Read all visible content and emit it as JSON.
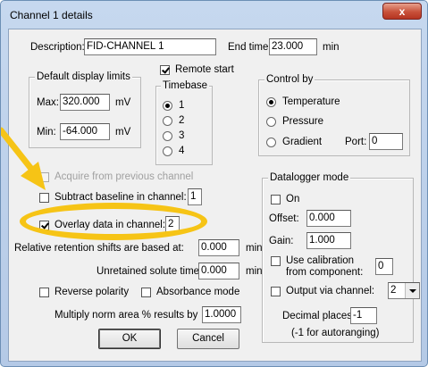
{
  "window": {
    "title": "Channel 1 details",
    "close_label": "x"
  },
  "description": {
    "label": "Description:",
    "value": "FID-CHANNEL 1"
  },
  "end_time": {
    "label": "End time:",
    "value": "23.000",
    "unit": "min"
  },
  "display_limits": {
    "title": "Default display limits",
    "max_label": "Max:",
    "max_value": "320.000",
    "max_unit": "mV",
    "min_label": "Min:",
    "min_value": "-64.000",
    "min_unit": "mV"
  },
  "remote_start": {
    "label": "Remote start",
    "checked": true
  },
  "timebase": {
    "title": "Timebase",
    "options": [
      "1",
      "2",
      "3",
      "4"
    ],
    "selected": "1"
  },
  "control_by": {
    "title": "Control by",
    "options": [
      "Temperature",
      "Pressure",
      "Gradient"
    ],
    "selected": "Temperature",
    "port_label": "Port:",
    "port_value": "0"
  },
  "acquire_previous": {
    "label": "Acquire from previous channel",
    "checked": false,
    "enabled": false
  },
  "subtract_baseline": {
    "label": "Subtract baseline in channel:",
    "value": "1",
    "checked": false
  },
  "overlay": {
    "label": "Overlay data in channel:",
    "value": "2",
    "checked": true
  },
  "relative_retention": {
    "label": "Relative retention shifts are based at:",
    "value": "0.000",
    "unit": "min"
  },
  "unretained": {
    "label": "Unretained solute time:",
    "value": "0.000",
    "unit": "min"
  },
  "reverse_polarity": {
    "label": "Reverse polarity",
    "checked": false
  },
  "absorbance_mode": {
    "label": "Absorbance mode",
    "checked": false
  },
  "multiply_norm": {
    "label": "Multiply norm area % results by",
    "value": "1.0000"
  },
  "datalogger": {
    "title": "Datalogger mode",
    "on_label": "On",
    "offset_label": "Offset:",
    "offset_value": "0.000",
    "gain_label": "Gain:",
    "gain_value": "1.000",
    "calibration_label_1": "Use calibration",
    "calibration_label_2": "from component:",
    "calibration_value": "0",
    "output_label": "Output via channel:",
    "output_value": "2",
    "decimal_label": "Decimal places:",
    "decimal_value": "-1",
    "decimal_note": "(-1 for autoranging)"
  },
  "buttons": {
    "ok": "OK",
    "cancel": "Cancel"
  },
  "colors": {
    "highlight": "#f6c416",
    "title_bar": "#c6d8ef",
    "close_button": "#c8513a"
  }
}
